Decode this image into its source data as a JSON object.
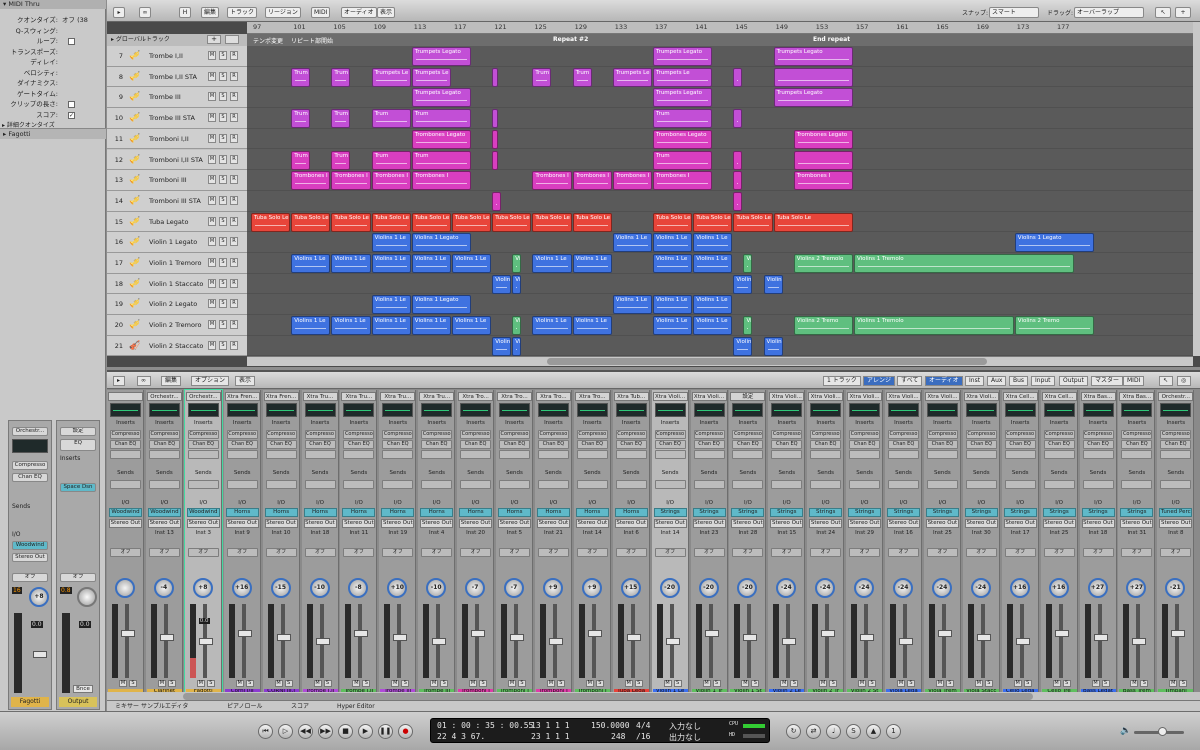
{
  "inspector": {
    "title": "MIDI Thru",
    "rows": [
      {
        "k": "クオンタイズ:",
        "v": "オフ (38"
      },
      {
        "k": "Q-スウィング:",
        "v": ""
      },
      {
        "k": "ループ:",
        "v": ""
      },
      {
        "k": "トランスポーズ:",
        "v": ""
      },
      {
        "k": "ディレイ:",
        "v": ""
      },
      {
        "k": "ベロシティ:",
        "v": ""
      },
      {
        "k": "ダイナミクス:",
        "v": ""
      },
      {
        "k": "ゲートタイム:",
        "v": ""
      },
      {
        "k": "クリップの長さ:",
        "v": ""
      },
      {
        "k": "スコア:",
        "v": ""
      }
    ],
    "detail_quantize": "詳細クオンタイズ",
    "fagotti_section": "Fagotti",
    "strip1": {
      "name": "Orchestr...",
      "inserts": "Compresso",
      "chan_eq": "Chan EQ",
      "sends": "Sends",
      "io": "I/O",
      "input": "Woodwind",
      "output": "Stereo Out",
      "auto": "オフ",
      "pan": "+8",
      "level": "0.0",
      "peak": "16",
      "peak2": "0.8",
      "name_bottom": "Fagotti"
    },
    "strip2": {
      "setting": "設定",
      "eq": "EQ",
      "inserts": "Inserts",
      "send": "Space Dsn",
      "auto": "オフ",
      "peak": "0.8",
      "level": "0.0",
      "name_bottom": "Output",
      "bnce": "Bnce"
    }
  },
  "arrange": {
    "toolbar": {
      "menus": [
        "編集",
        "トラック",
        "リージョン",
        "MIDI",
        "オーディオ",
        "表示"
      ],
      "snap_label": "スナップ:",
      "snap_value": "スマート",
      "drag_label": "ドラッグ:",
      "drag_value": "オーバーラップ"
    },
    "global_tracks": "グローバルトラック",
    "bars": [
      "97",
      "101",
      "105",
      "109",
      "113",
      "117",
      "121",
      "125",
      "129",
      "133",
      "137",
      "141",
      "145",
      "149",
      "153",
      "157",
      "161",
      "165",
      "169",
      "173",
      "177"
    ],
    "markers": [
      {
        "text": "テンポ変更"
      },
      {
        "text": "リピート部開始"
      },
      {
        "text": "Repeat #2"
      },
      {
        "text": "End repeat"
      }
    ],
    "tracks": [
      {
        "num": "7",
        "name": "Trombe I,II"
      },
      {
        "num": "8",
        "name": "Trombe I,II STA"
      },
      {
        "num": "9",
        "name": "Trombe III"
      },
      {
        "num": "10",
        "name": "Trombe III STA"
      },
      {
        "num": "11",
        "name": "Tromboni I,II"
      },
      {
        "num": "12",
        "name": "Tromboni I,II STA"
      },
      {
        "num": "13",
        "name": "Tromboni III"
      },
      {
        "num": "14",
        "name": "Tromboni III STA"
      },
      {
        "num": "15",
        "name": "Tuba Legato"
      },
      {
        "num": "16",
        "name": "Violin 1 Legato"
      },
      {
        "num": "17",
        "name": "Violin 1 Tremoro"
      },
      {
        "num": "18",
        "name": "Violin 1 Staccato"
      },
      {
        "num": "19",
        "name": "Violin 2 Legato"
      },
      {
        "num": "20",
        "name": "Violin 2 Tremoro"
      },
      {
        "num": "21",
        "name": "Violin 2 Staccato"
      }
    ],
    "region_names": {
      "tpl": "Trumpets Legato",
      "tpl_short": "Trumpets Le",
      "trum": "Trum",
      "tbl": "Trombones Legato",
      "tbl_short": "Trombones I",
      "tuba": "Tuba Solo Le",
      "v1l": "Violins 1 Legato",
      "v1l_short": "Violins 1 Le",
      "v2t": "Violins 2 Tremolo",
      "v1t": "Violins 1 Tremolo",
      "vi": "Violin",
      "v2t_short": "Violins 2 Tremo"
    }
  },
  "mixer": {
    "toolbar": {
      "menus": [
        "編集",
        "オプション",
        "表示"
      ],
      "views": [
        "1 トラック",
        "アレンジ",
        "すべて"
      ],
      "filters": [
        "オーディオ",
        "Inst",
        "Aux",
        "Bus",
        "Input",
        "Output",
        "マスター",
        "MIDI"
      ]
    },
    "labels": {
      "inserts": "Inserts",
      "chan_eq": "Chan EQ",
      "sends": "Sends",
      "io": "I/O",
      "stereo_out": "Stereo Out",
      "off": "オフ",
      "compressor": "Compresso",
      "setting": "設定"
    },
    "strips": [
      {
        "name": "",
        "io": "Woodwind",
        "inst": "",
        "pan": "",
        "bottom": "",
        "num": "",
        "color": "#e0b44a"
      },
      {
        "name": "Orchestr...",
        "io": "Woodwind",
        "inst": "Inst 13",
        "pan": "-4",
        "bottom": "Clarinet",
        "num": "3",
        "color": "#e0b44a"
      },
      {
        "name": "Orchestr...",
        "io": "Woodwind",
        "inst": "Inst 3",
        "pan": "+8",
        "bottom": "Fagotti",
        "num": "4",
        "color": "#e0b44a",
        "level": "0.0",
        "sel": true
      },
      {
        "name": "Xtra Fren...",
        "io": "Horns",
        "inst": "Inst 9",
        "pan": "+16",
        "bottom": "Corni I/II",
        "num": "5",
        "color": "#8c3bd1"
      },
      {
        "name": "Xtra Fren...",
        "io": "Horns",
        "inst": "Inst 10",
        "pan": "-15",
        "bottom": "CORNI III,I",
        "num": "6",
        "color": "#8c3bd1"
      },
      {
        "name": "Xtra Tru...",
        "io": "Horns",
        "inst": "Inst 18",
        "pan": "-10",
        "bottom": "Trombe I,II",
        "num": "7",
        "color": "#b04bd9"
      },
      {
        "name": "Xtra Tru...",
        "io": "Horns",
        "inst": "Inst 11",
        "pan": "-8",
        "bottom": "Trombe I,II",
        "num": "8",
        "color": "#5fbf5f"
      },
      {
        "name": "Xtra Tru...",
        "io": "Horns",
        "inst": "Inst 19",
        "pan": "+10",
        "bottom": "Trombe III",
        "num": "9",
        "color": "#b04bd9"
      },
      {
        "name": "Xtra Tru...",
        "io": "Horns",
        "inst": "Inst 4",
        "pan": "-10",
        "bottom": "Trombe III",
        "num": "10",
        "color": "#5fbf5f"
      },
      {
        "name": "Xtra Tro...",
        "io": "Horns",
        "inst": "Inst 20",
        "pan": "-7",
        "bottom": "Tromboni I",
        "num": "11",
        "color": "#e03aa8"
      },
      {
        "name": "Xtra Tro...",
        "io": "Horns",
        "inst": "Inst 5",
        "pan": "-7",
        "bottom": "Tromboni I",
        "num": "12",
        "color": "#5fbf5f"
      },
      {
        "name": "Xtra Tro...",
        "io": "Horns",
        "inst": "Inst 21",
        "pan": "+9",
        "bottom": "Tromboni I",
        "num": "13",
        "color": "#e03aa8"
      },
      {
        "name": "Xtra Tro...",
        "io": "Horns",
        "inst": "Inst 14",
        "pan": "+9",
        "bottom": "Tromboni I",
        "num": "14",
        "color": "#5fbf5f"
      },
      {
        "name": "Xtra Tub...",
        "io": "Horns",
        "inst": "Inst 6",
        "pan": "+15",
        "bottom": "Tuba Lega",
        "num": "15",
        "color": "#e8423a"
      },
      {
        "name": "Xtra Violi...",
        "io": "Strings",
        "inst": "Inst 14",
        "pan": "-20",
        "bottom": "Violin 1 Le",
        "num": "16",
        "color": "#3b6ff0",
        "sel": true
      },
      {
        "name": "Xtra Violi...",
        "io": "Strings",
        "inst": "Inst 23",
        "pan": "-20",
        "bottom": "Violin 1 Tr",
        "num": "17",
        "color": "#5fbf5f"
      },
      {
        "name": "設定",
        "io": "Strings",
        "inst": "Inst 28",
        "pan": "-20",
        "bottom": "Violin 1 St",
        "num": "18",
        "color": "#5fbf5f"
      },
      {
        "name": "Xtra Violi...",
        "io": "Strings",
        "inst": "Inst 15",
        "pan": "-24",
        "bottom": "Violin 2 Le",
        "num": "19",
        "color": "#3b6ff0"
      },
      {
        "name": "Xtra Violi...",
        "io": "Strings",
        "inst": "Inst 24",
        "pan": "-24",
        "bottom": "Violin 2 Tr",
        "num": "20",
        "color": "#5fbf5f"
      },
      {
        "name": "Xtra Violi...",
        "io": "Strings",
        "inst": "Inst 29",
        "pan": "-24",
        "bottom": "Violin 2 St",
        "num": "21",
        "color": "#5fbf5f"
      },
      {
        "name": "Xtra Violi...",
        "io": "Strings",
        "inst": "Inst 16",
        "pan": "-24",
        "bottom": "Viola Lega",
        "num": "22",
        "color": "#3b6ff0"
      },
      {
        "name": "Xtra Violi...",
        "io": "Strings",
        "inst": "Inst 25",
        "pan": "-24",
        "bottom": "Viola Trem",
        "num": "23",
        "color": "#5fbf5f"
      },
      {
        "name": "Xtra Violi...",
        "io": "Strings",
        "inst": "Inst 30",
        "pan": "-24",
        "bottom": "Viola Stacc",
        "num": "24",
        "color": "#5fbf5f"
      },
      {
        "name": "Xtra Cell...",
        "io": "Strings",
        "inst": "Inst 17",
        "pan": "+16",
        "bottom": "Cello Lega",
        "num": "25",
        "color": "#3b6ff0"
      },
      {
        "name": "Xtra Cell...",
        "io": "Strings",
        "inst": "Inst 25",
        "pan": "+16",
        "bottom": "Cello Tre",
        "num": "26",
        "color": "#5fbf5f"
      },
      {
        "name": "Xtra Bas...",
        "io": "Strings",
        "inst": "Inst 18",
        "pan": "+27",
        "bottom": "Bass Legat",
        "num": "27",
        "color": "#3b6ff0"
      },
      {
        "name": "Xtra Bas...",
        "io": "Strings",
        "inst": "Inst 31",
        "pan": "+27",
        "bottom": "Bass Trem",
        "num": "28",
        "color": "#5fbf5f"
      },
      {
        "name": "Orchestr...",
        "io": "Tuned Perc",
        "inst": "Inst 8",
        "pan": "-21",
        "bottom": "Timpani",
        "num": "29",
        "color": "#5fbf5f"
      }
    ]
  },
  "bottom_tabs": [
    "ミキサー",
    "サンプルエディタ",
    "ピアノロール",
    "スコア",
    "Hyper Editor"
  ],
  "transport": {
    "time": "01 : 00 : 35 : 00.55",
    "frames": "22    4    3   67.",
    "bars": "13    1    1      1",
    "bars2": "23    1    1      1",
    "tempo": "150.0000",
    "tempo_sub": "248",
    "sig": "4/4",
    "sig_sub": "/16",
    "in_label": "入力なし",
    "out_label": "出力なし",
    "cpu": "CPU",
    "hd": "HD"
  }
}
